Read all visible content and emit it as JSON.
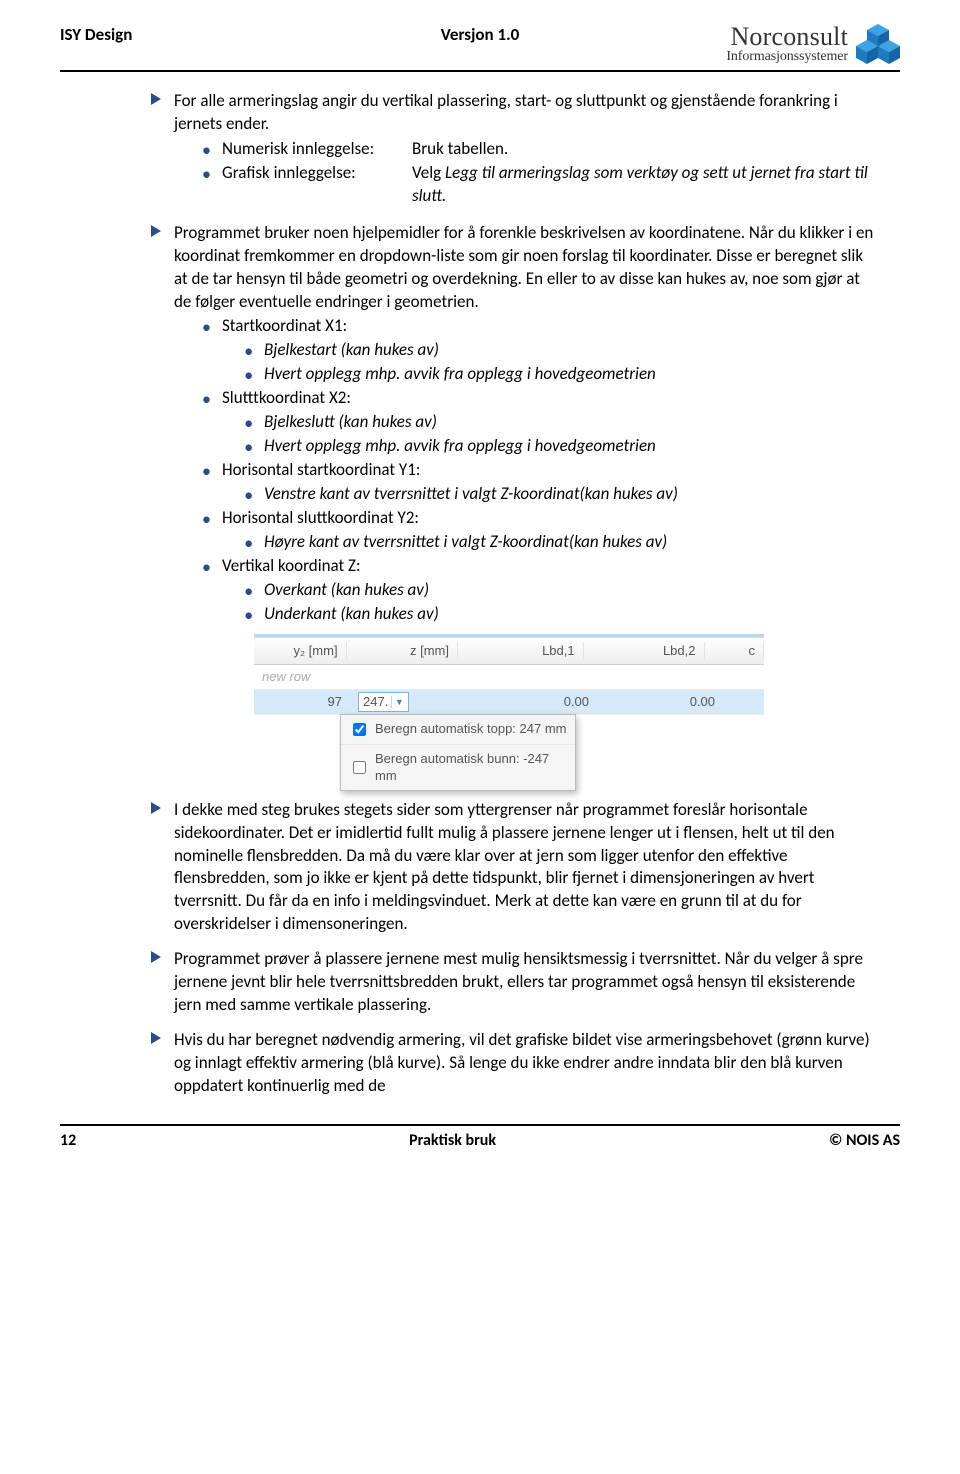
{
  "header": {
    "left": "ISY Design",
    "center": "Versjon 1.0",
    "logo_title": "Norconsult",
    "logo_sub": "Informasjonssystemer"
  },
  "section1": {
    "intro": "For alle armeringslag angir du vertikal plassering, start- og sluttpunkt og gjenstående forankring i jernets ender.",
    "row1_key": "Numerisk innleggelse:",
    "row1_val": "Bruk tabellen.",
    "row2_key": "Grafisk innleggelse:",
    "row2_val_a": "Velg ",
    "row2_val_b": "Legg til armeringslag som verktøy og sett ut jernet fra start til slutt."
  },
  "section2": {
    "para": "Programmet bruker noen hjelpemidler for å forenkle beskrivelsen av koordinatene. Når du klikker i en koordinat fremkommer en dropdown-liste som gir noen forslag til koordinater. Disse er beregnet slik at de tar hensyn til både geometri og overdekning. En eller to av disse kan hukes av, noe som gjør at de følger eventuelle endringer i geometrien.",
    "items": {
      "x1": "Startkoordinat X1:",
      "x1_a": "Bjelkestart (kan hukes av)",
      "x1_b": "Hvert opplegg mhp. avvik fra opplegg i hovedgeometrien",
      "x2": "Slutttkoordinat X2:",
      "x2_a": "Bjelkeslutt (kan hukes av)",
      "x2_b": "Hvert opplegg mhp. avvik fra opplegg i hovedgeometrien",
      "y1": "Horisontal startkoordinat Y1:",
      "y1_a": "Venstre kant av tverrsnittet i valgt Z-koordinat(kan hukes av)",
      "y2": "Horisontal sluttkoordinat Y2:",
      "y2_a": "Høyre kant av tverrsnittet i valgt Z-koordinat(kan hukes av)",
      "z": "Vertikal koordinat Z:",
      "z_a": "Overkant (kan hukes av)",
      "z_b": "Underkant (kan hukes av)"
    }
  },
  "table": {
    "headers": {
      "y2": "y₂ [mm]",
      "z": "z [mm]",
      "lbd1": "Lbd,1",
      "lbd2": "Lbd,2",
      "c": "c"
    },
    "newrow": "new row",
    "row": {
      "y2": "97",
      "z": "247.",
      "lbd1": "0.00",
      "lbd2": "0.00"
    },
    "dropdown": {
      "opt1": "Beregn automatisk topp: 247 mm",
      "opt2": "Beregn automatisk bunn: -247 mm"
    }
  },
  "section3": {
    "p1": "I dekke med steg brukes stegets sider som yttergrenser når programmet foreslår horisontale sidekoordinater. Det er imidlertid fullt mulig å plassere jernene lenger ut i flensen, helt ut til den nominelle flensbredden. Da må du være klar over at jern som ligger utenfor den effektive flensbredden, som jo ikke er kjent på dette tidspunkt, blir fjernet i dimensjoneringen av hvert tverrsnitt. Du får da en info i meldingsvinduet. Merk at dette kan være en grunn til at du for overskridelser i dimensoneringen.",
    "p2": "Programmet prøver å plassere jernene mest mulig hensiktsmessig i tverrsnittet. Når du velger å spre jernene jevnt blir hele tverrsnittsbredden brukt, ellers tar programmet også hensyn til eksisterende jern med samme vertikale plassering.",
    "p3": "Hvis du har beregnet nødvendig armering, vil det grafiske bildet vise armeringsbehovet (grønn kurve) og innlagt effektiv armering (blå kurve). Så lenge du ikke endrer andre inndata blir den blå kurven oppdatert kontinuerlig med de"
  },
  "footer": {
    "page": "12",
    "center": "Praktisk bruk",
    "right": "© NOIS AS"
  }
}
